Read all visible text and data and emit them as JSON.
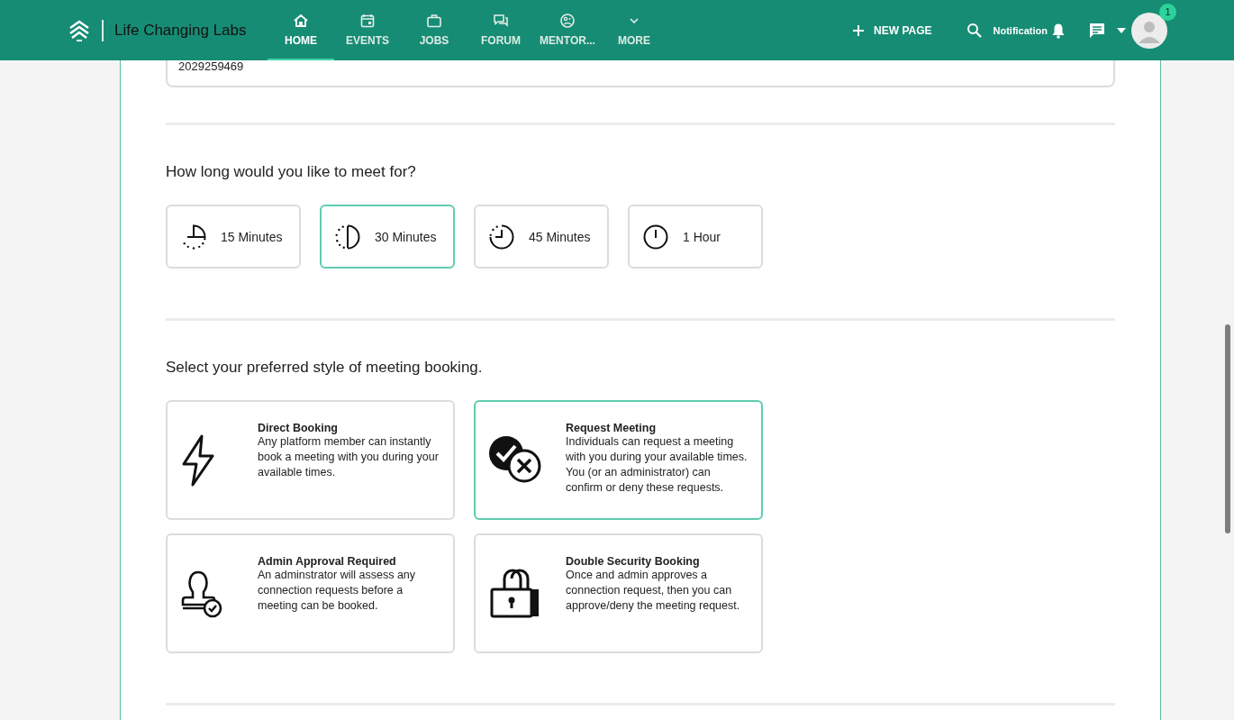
{
  "brand": {
    "name": "Life Changing Labs"
  },
  "nav": [
    {
      "label": "HOME",
      "selected": true
    },
    {
      "label": "EVENTS",
      "selected": false
    },
    {
      "label": "JOBS",
      "selected": false
    },
    {
      "label": "FORUM",
      "selected": false
    },
    {
      "label": "MENTOR...",
      "selected": false
    },
    {
      "label": "MORE",
      "selected": false
    }
  ],
  "actions": {
    "new_page": "NEW PAGE",
    "notification": "Notification",
    "badge": "1"
  },
  "phone_field": {
    "value": "2029259469"
  },
  "duration": {
    "question": "How long would you like to meet for?",
    "options": [
      {
        "label": "15 Minutes",
        "selected": false
      },
      {
        "label": "30 Minutes",
        "selected": true
      },
      {
        "label": "45 Minutes",
        "selected": false
      },
      {
        "label": "1 Hour",
        "selected": false
      }
    ]
  },
  "booking_style": {
    "question": "Select your preferred style of meeting booking.",
    "options": [
      {
        "title": "Direct Booking",
        "description": "Any platform member can instantly book a meeting with you during your available times.",
        "selected": false
      },
      {
        "title": "Request Meeting",
        "description": "Individuals can request a meeting with you during your available times. You (or an administrator) can confirm or deny these requests.",
        "selected": true
      },
      {
        "title": "Admin Approval Required",
        "description": "An adminstrator will assess any connection requests before a meeting can be booked.",
        "selected": false
      },
      {
        "title": "Double Security Booking",
        "description": "Once and admin approves a connection request, then you can approve/deny the meeting request.",
        "selected": false
      }
    ]
  }
}
